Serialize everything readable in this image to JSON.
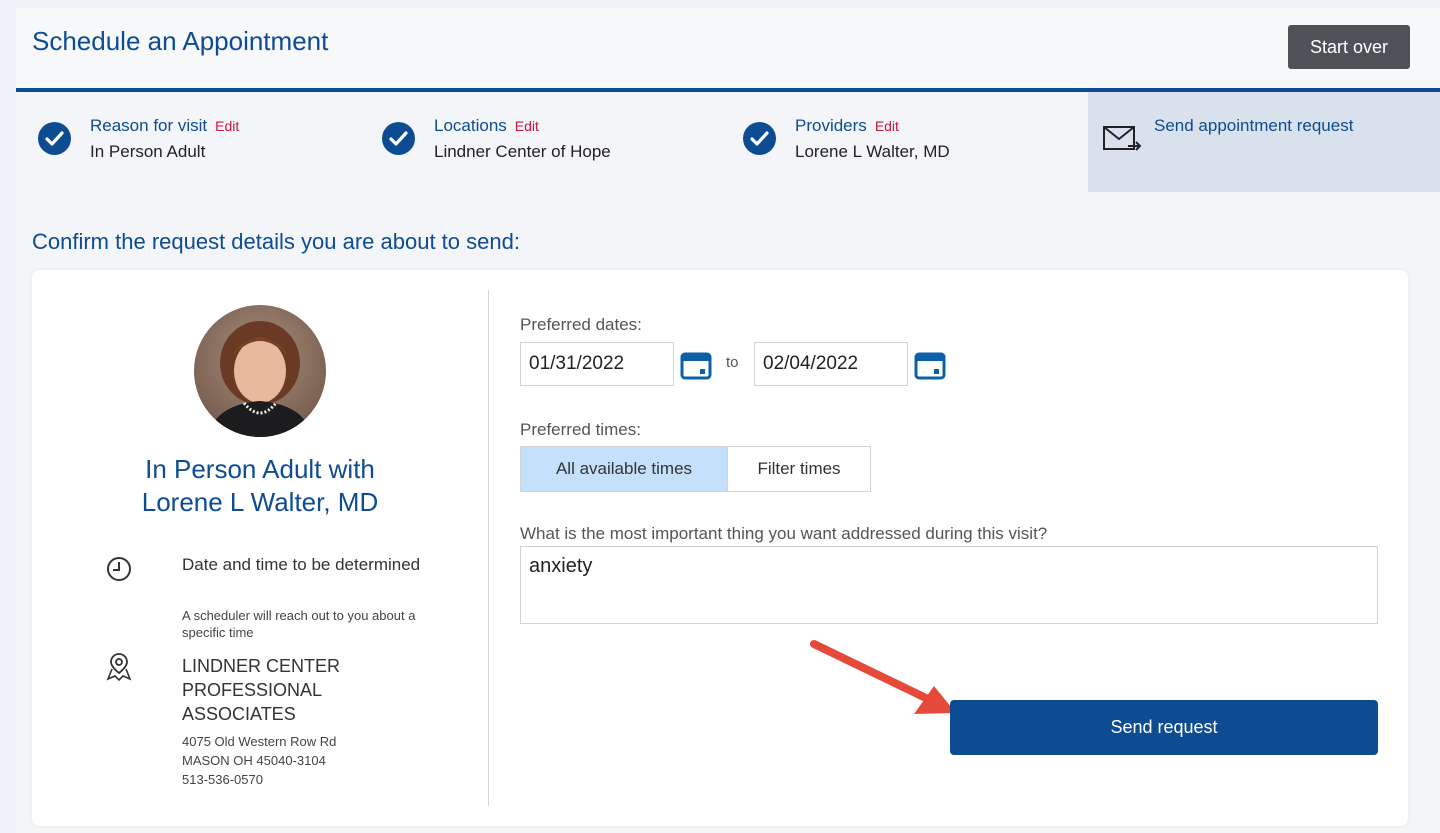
{
  "header": {
    "title": "Schedule an Appointment",
    "start_over_label": "Start over"
  },
  "steps": [
    {
      "label": "Reason for visit",
      "edit": "Edit",
      "value": "In Person Adult"
    },
    {
      "label": "Locations",
      "edit": "Edit",
      "value": "Lindner Center of Hope"
    },
    {
      "label": "Providers",
      "edit": "Edit",
      "value": "Lorene L Walter, MD"
    }
  ],
  "send_step": {
    "label": "Send appointment request",
    "icon": "envelope-icon"
  },
  "confirm_title": "Confirm the request details you are about to send:",
  "provider": {
    "title_line1": "In Person Adult with",
    "title_line2": "Lorene L Walter, MD",
    "datetime_main": "Date and time to be determined",
    "datetime_sub": "A scheduler will reach out to you about a specific time",
    "location_name_line1": "LINDNER CENTER",
    "location_name_line2": "PROFESSIONAL",
    "location_name_line3": "ASSOCIATES",
    "address_line1": "4075 Old Western Row Rd",
    "address_line2": "MASON OH 45040-3104",
    "phone": "513-536-0570"
  },
  "form": {
    "preferred_dates_label": "Preferred dates:",
    "start_date": "01/31/2022",
    "to_label": "to",
    "end_date": "02/04/2022",
    "preferred_times_label": "Preferred times:",
    "time_options": [
      "All available times",
      "Filter times"
    ],
    "selected_time_option": "All available times",
    "question_label": "What is the most important thing you want addressed during this visit?",
    "question_value": "anxiety",
    "send_label": "Send request"
  },
  "colors": {
    "primary": "#0d4c92",
    "edit": "#c3173c",
    "active_segment": "#c5e0fa",
    "arrow": "#e4493a"
  }
}
